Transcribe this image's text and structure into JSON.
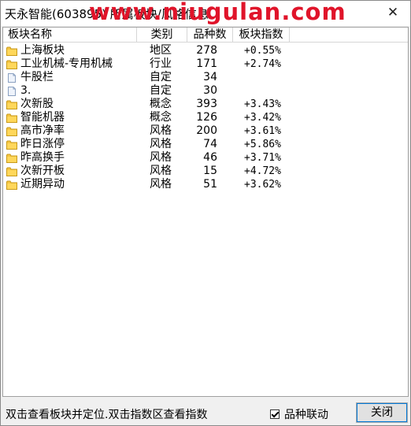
{
  "window": {
    "title": "天永智能(603895) 所属板块/风格信息",
    "watermark": "www.niugulan.com"
  },
  "table": {
    "headers": [
      "板块名称",
      "类别",
      "品种数",
      "板块指数"
    ],
    "rows": [
      {
        "icon": "folder-icon",
        "name": "上海板块",
        "type": "地区",
        "count": "278",
        "index": "+0.55%"
      },
      {
        "icon": "folder-icon",
        "name": "工业机械-专用机械",
        "type": "行业",
        "count": "171",
        "index": "+2.74%"
      },
      {
        "icon": "document-icon",
        "name": "牛股栏",
        "type": "自定",
        "count": "34",
        "index": ""
      },
      {
        "icon": "document-icon",
        "name": "3.",
        "type": "自定",
        "count": "30",
        "index": ""
      },
      {
        "icon": "folder-icon",
        "name": "次新股",
        "type": "概念",
        "count": "393",
        "index": "+3.43%"
      },
      {
        "icon": "folder-icon",
        "name": "智能机器",
        "type": "概念",
        "count": "126",
        "index": "+3.42%"
      },
      {
        "icon": "folder-icon",
        "name": "高市净率",
        "type": "风格",
        "count": "200",
        "index": "+3.61%"
      },
      {
        "icon": "folder-icon",
        "name": "昨日涨停",
        "type": "风格",
        "count": "74",
        "index": "+5.86%"
      },
      {
        "icon": "folder-icon",
        "name": "昨高换手",
        "type": "风格",
        "count": "46",
        "index": "+3.71%"
      },
      {
        "icon": "folder-icon",
        "name": "次新开板",
        "type": "风格",
        "count": "15",
        "index": "+4.72%"
      },
      {
        "icon": "folder-icon",
        "name": "近期异动",
        "type": "风格",
        "count": "51",
        "index": "+3.62%"
      }
    ]
  },
  "footer": {
    "hint": "双击查看板块并定位.双击指数区查看指数",
    "checkbox_label": "品种联动",
    "checkbox_checked": true,
    "close_label": "关闭"
  }
}
